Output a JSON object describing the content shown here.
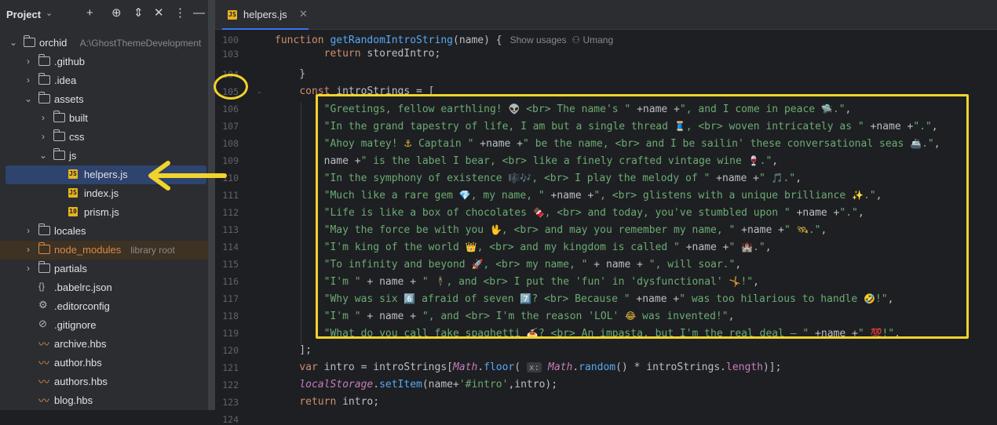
{
  "project_panel": {
    "title": "Project",
    "tree": [
      {
        "label": "orchid",
        "meta": "A:\\GhostThemeDevelopment",
        "depth": 0,
        "type": "folder",
        "open": true
      },
      {
        "label": ".github",
        "depth": 1,
        "type": "folder",
        "open": false
      },
      {
        "label": ".idea",
        "depth": 1,
        "type": "folder",
        "open": false
      },
      {
        "label": "assets",
        "depth": 1,
        "type": "folder",
        "open": true
      },
      {
        "label": "built",
        "depth": 2,
        "type": "folder",
        "open": false
      },
      {
        "label": "css",
        "depth": 2,
        "type": "folder",
        "open": false
      },
      {
        "label": "js",
        "depth": 2,
        "type": "folder",
        "open": true
      },
      {
        "label": "helpers.js",
        "depth": 3,
        "type": "js",
        "selected": true
      },
      {
        "label": "index.js",
        "depth": 3,
        "type": "js"
      },
      {
        "label": "prism.js",
        "depth": 3,
        "type": "js-min"
      },
      {
        "label": "locales",
        "depth": 1,
        "type": "folder",
        "open": false
      },
      {
        "label": "node_modules",
        "meta": "library root",
        "depth": 1,
        "type": "folder-lib",
        "open": false
      },
      {
        "label": "partials",
        "depth": 1,
        "type": "folder",
        "open": false
      },
      {
        "label": ".babelrc.json",
        "depth": 1,
        "type": "json"
      },
      {
        "label": ".editorconfig",
        "depth": 1,
        "type": "config"
      },
      {
        "label": ".gitignore",
        "depth": 1,
        "type": "ignore"
      },
      {
        "label": "archive.hbs",
        "depth": 1,
        "type": "hbs"
      },
      {
        "label": "author.hbs",
        "depth": 1,
        "type": "hbs"
      },
      {
        "label": "authors.hbs",
        "depth": 1,
        "type": "hbs"
      },
      {
        "label": "blog.hbs",
        "depth": 1,
        "type": "hbs"
      }
    ]
  },
  "editor": {
    "tab_label": "helpers.js",
    "hint_usages": "Show usages",
    "hint_author": "Umang",
    "lines": [
      {
        "n": "100",
        "html": "<span class='kw'>function</span> <span class='fn'>getRandomIntroString</span>(name) {"
      },
      {
        "n": "103",
        "html": "        <span class='kw'>return</span> storedIntro;"
      },
      {
        "n": "104",
        "html": "    }"
      },
      {
        "n": "105",
        "html": "    <span class='kw'>const</span> introStrings = ["
      },
      {
        "n": "106",
        "html": "        <span class='str'>\"Greetings, fellow earthling! <span class='emj'>👽</span> &lt;br&gt; The name's \"</span> +name +<span class='str'>\", and I come in peace <span class='emj'>🛸</span>.\"</span>,"
      },
      {
        "n": "107",
        "html": "        <span class='str'>\"In the grand tapestry of life, I am but a single thread <span class='emj'>🧵</span>, &lt;br&gt; woven intricately as \"</span> +name +<span class='str'>\".\"</span>,"
      },
      {
        "n": "108",
        "html": "        <span class='str'>\"Ahoy matey! <span class='emj'>⚓</span> Captain \"</span> +name +<span class='str'>\" be the name, &lt;br&gt; and I be sailin' these conversational seas <span class='emj'>🚢</span>.\"</span>,"
      },
      {
        "n": "109",
        "html": "        name +<span class='str'>\" is the label I bear, &lt;br&gt; like a finely crafted vintage wine <span class='emj'>🍷</span>.\"</span>,"
      },
      {
        "n": "110",
        "html": "        <span class='str'>\"In the symphony of existence <span class='emj'>🎼🎶</span>, &lt;br&gt; I play the melody of \"</span> +name +<span class='str'>\" <span class='emj'>🎵</span>.\"</span>,"
      },
      {
        "n": "111",
        "html": "        <span class='str'>\"Much like a rare gem <span class='emj'>💎</span>, my name, \"</span> +name +<span class='str'>\", &lt;br&gt; glistens with a unique brilliance <span class='emj'>✨</span>.\"</span>,"
      },
      {
        "n": "112",
        "html": "        <span class='str'>\"Life is like a box of chocolates <span class='emj'>🍫</span>, &lt;br&gt; and today, you've stumbled upon \"</span> +name +<span class='str'>\".\"</span>,"
      },
      {
        "n": "113",
        "html": "        <span class='str'>\"May the force be with you <span class='emj'>🖖</span>, &lt;br&gt; and may you remember my name, \"</span> +name +<span class='str'>\" <span class='emj'>🛰</span>.\"</span>,"
      },
      {
        "n": "114",
        "html": "        <span class='str'>\"I'm king of the world <span class='emj'>👑</span>, &lt;br&gt; and my kingdom is called \"</span> +name +<span class='str'>\" <span class='emj'>🏰</span>.\"</span>,"
      },
      {
        "n": "115",
        "html": "        <span class='str'>\"To infinity and beyond <span class='emj'>🚀</span>, &lt;br&gt; my name, \"</span> + name + <span class='str'>\", will soar.\"</span>,"
      },
      {
        "n": "116",
        "html": "        <span class='str'>\"I'm \"</span> + name + <span class='str'>\" <span class='emj'>🕴</span>, and &lt;br&gt; I put the 'fun' in 'dysfunctional' <span class='emj'>🤸</span>!\"</span>,"
      },
      {
        "n": "117",
        "html": "        <span class='str'>\"Why was six <span class='emj'>6️⃣</span> afraid of seven <span class='emj'>7️⃣</span>? &lt;br&gt; Because \"</span> +name +<span class='str'>\" was too hilarious to handle <span class='emj'>🤣</span>!\"</span>,"
      },
      {
        "n": "118",
        "html": "        <span class='str'>\"I'm \"</span> + name + <span class='str'>\", and &lt;br&gt; I'm the reason 'LOL' <span class='emj'>😂</span> was invented!\"</span>,"
      },
      {
        "n": "119",
        "html": "        <span class='str'>\"What do you call fake spaghetti <span class='emj'>🍝</span>? &lt;br&gt; An impasta, but I'm the real deal – \"</span> +name +<span class='str'>\" <span class='emj'>💯</span>!\"</span>,"
      },
      {
        "n": "120",
        "html": "    ];"
      },
      {
        "n": "121",
        "html": "    <span class='kw'>var</span> intro = introStrings[<span class='it'>Math</span>.<span class='fn'>floor</span>( <span class='inlay'>x:</span> <span class='it'>Math</span>.<span class='fn'>random</span>() * introStrings.<span class='prop'>length</span>)];"
      },
      {
        "n": "122",
        "html": "    <span class='it'>localStorage</span>.<span class='fn'>setItem</span>(name+<span class='str'>'#intro'</span>,intro);"
      },
      {
        "n": "123",
        "html": "    <span class='kw'>return</span> intro;"
      },
      {
        "n": "124",
        "html": "}"
      }
    ]
  },
  "annotation_color": "#f2d32b"
}
